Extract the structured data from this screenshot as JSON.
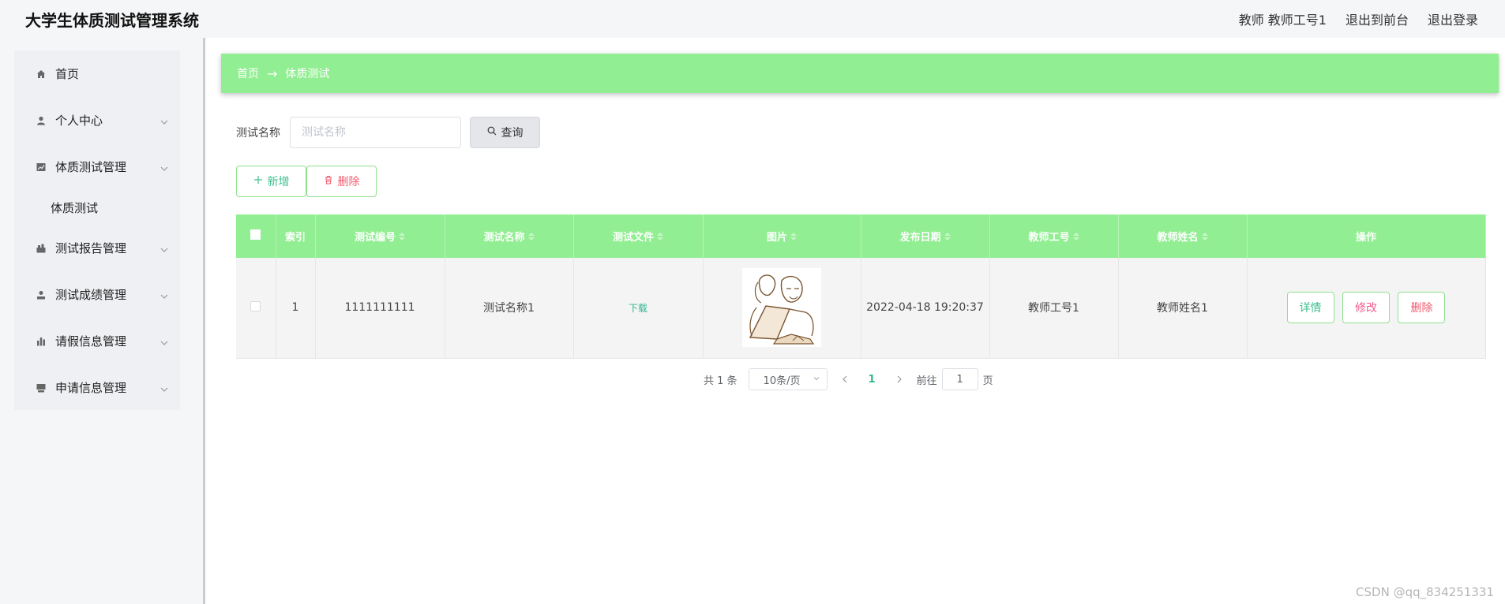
{
  "app": {
    "title": "大学生体质测试管理系统",
    "user_label": "教师 教师工号1",
    "to_frontend": "退出到前台",
    "logout": "退出登录"
  },
  "sidebar": {
    "items": [
      {
        "label": "首页",
        "icon": "home-icon"
      },
      {
        "label": "个人中心",
        "icon": "user-icon"
      },
      {
        "label": "体质测试管理",
        "icon": "chart-icon",
        "children": [
          {
            "label": "体质测试"
          }
        ]
      },
      {
        "label": "测试报告管理",
        "icon": "report-icon"
      },
      {
        "label": "测试成绩管理",
        "icon": "person-icon"
      },
      {
        "label": "请假信息管理",
        "icon": "bar-chart-icon"
      },
      {
        "label": "申请信息管理",
        "icon": "inbox-icon"
      }
    ]
  },
  "breadcrumb": {
    "home": "首页",
    "arrow": "→",
    "current": "体质测试"
  },
  "search": {
    "label": "测试名称",
    "placeholder": "测试名称",
    "value": "",
    "query_button": "查询"
  },
  "actions": {
    "add": "新增",
    "delete": "删除"
  },
  "table": {
    "columns": [
      "索引",
      "测试编号",
      "测试名称",
      "测试文件",
      "图片",
      "发布日期",
      "教师工号",
      "教师姓名",
      "操作"
    ],
    "rows": [
      {
        "index": "1",
        "test_no": "1111111111",
        "test_name": "测试名称1",
        "test_file": "下载",
        "publish_date": "2022-04-18 19:20:37",
        "teacher_no": "教师工号1",
        "teacher_name": "教师姓名1",
        "ops": {
          "detail": "详情",
          "edit": "修改",
          "delete": "删除"
        }
      }
    ]
  },
  "pagination": {
    "total": "共 1 条",
    "page_size": "10条/页",
    "current_page": "1",
    "goto_label": "前往",
    "goto_value": "1",
    "page_suffix": "页"
  },
  "watermark": "CSDN @qq_834251331",
  "colors": {
    "accent_green": "#92ee92",
    "link_green": "#2fb890",
    "danger": "#f15b6c"
  }
}
